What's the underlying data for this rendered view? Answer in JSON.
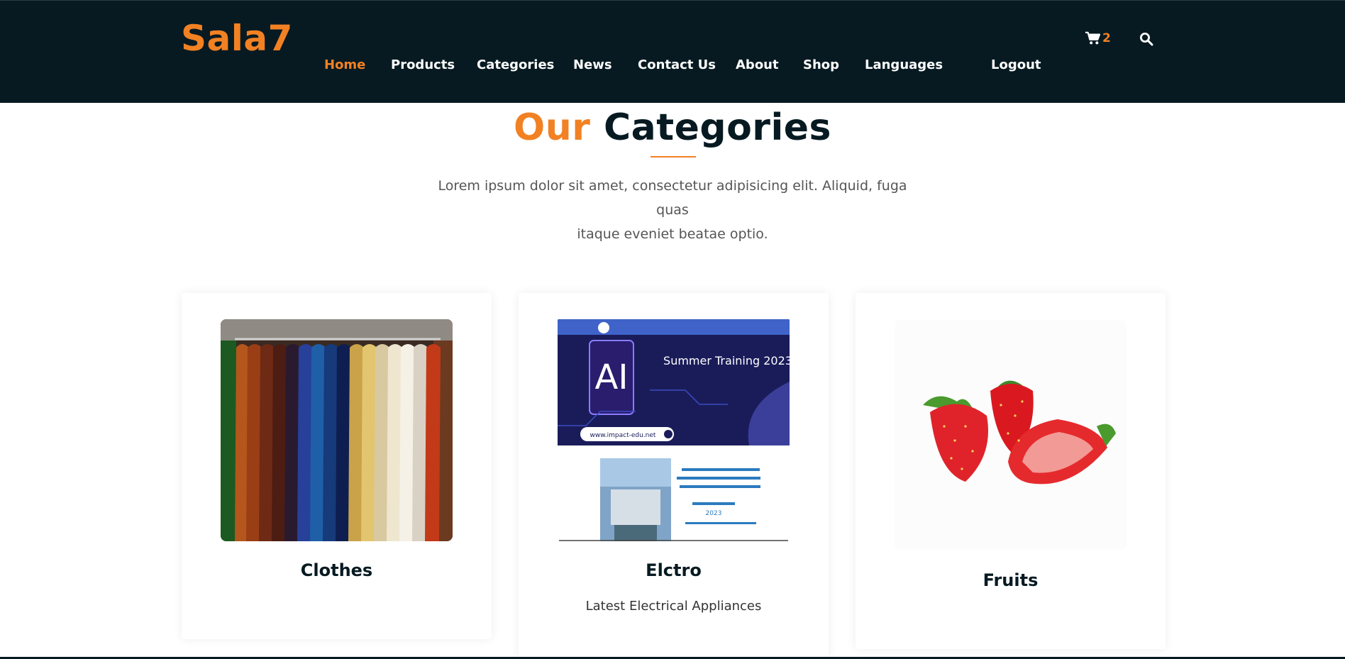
{
  "header": {
    "logo": "Sala7",
    "nav": [
      {
        "label": "Home",
        "active": true
      },
      {
        "label": "Products"
      },
      {
        "label": "Categories"
      },
      {
        "label": "News"
      },
      {
        "label": "Contact Us"
      },
      {
        "label": "About"
      },
      {
        "label": "Shop"
      },
      {
        "label": "Languages"
      },
      {
        "label": "Logout"
      }
    ],
    "cart_count": "2",
    "icons": {
      "cart": "cart-icon",
      "search": "search-icon"
    },
    "colors": {
      "background": "#071a22",
      "accent": "#f28123"
    }
  },
  "section": {
    "title_accent": "Our",
    "title_main": "Categories",
    "description_line1": "Lorem ipsum dolor sit amet, consectetur adipisicing elit. Aliquid, fuga quas",
    "description_line2": "itaque eveniet beatae optio."
  },
  "categories": [
    {
      "title": "Clothes",
      "subtitle": ""
    },
    {
      "title": "Elctro",
      "subtitle": "Latest Electrical Appliances",
      "image_text": {
        "badge": "AI",
        "heading": "Summer Training 2023",
        "url": "www.impact-edu.net",
        "year": "2023"
      }
    },
    {
      "title": "Fruits",
      "subtitle": ""
    }
  ]
}
